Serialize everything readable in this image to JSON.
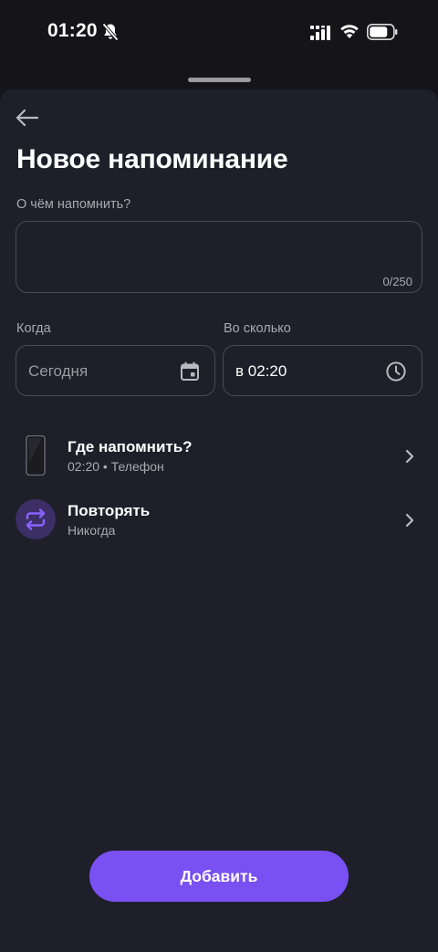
{
  "status_bar": {
    "time": "01:20",
    "icons": [
      "bell-off-icon",
      "signal-icon",
      "wifi-icon",
      "battery-icon"
    ]
  },
  "header": {
    "back_icon": "arrow-left-icon",
    "title": "Новое напоминание"
  },
  "reminder_text": {
    "label": "О чём напомнить?",
    "value": "",
    "counter": "0/250"
  },
  "when": {
    "label": "Когда",
    "value": "Сегодня",
    "icon": "calendar-icon"
  },
  "time": {
    "label": "Во сколько",
    "value": "в 02:20",
    "icon": "clock-icon"
  },
  "settings": [
    {
      "title": "Где напомнить?",
      "subtitle": "02:20 • Телефон",
      "icon": "phone-icon"
    },
    {
      "title": "Повторять",
      "subtitle": "Никогда",
      "icon": "repeat-icon"
    }
  ],
  "actions": {
    "add_label": "Добавить"
  },
  "colors": {
    "background": "#141419",
    "sheet": "#1f1f2a",
    "accent": "#7950f2",
    "border": "#4a4a56",
    "muted_text": "#a9a9b1"
  }
}
